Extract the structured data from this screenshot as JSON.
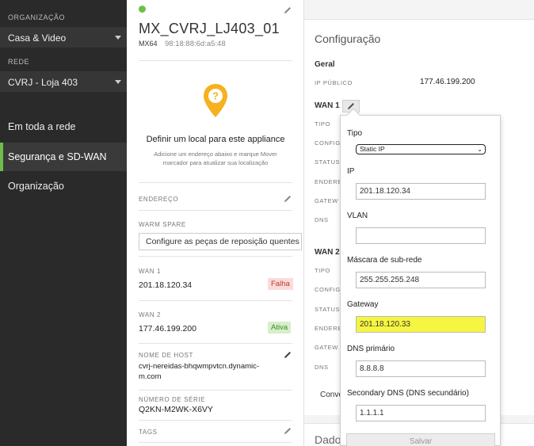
{
  "sidebar": {
    "org_label": "ORGANIZAÇÃO",
    "org_value": "Casa & Video",
    "network_label": "REDE",
    "network_value": "CVRJ - Loja 403",
    "nav": [
      "Em toda a rede",
      "Segurança e SD-WAN",
      "Organização"
    ],
    "active_nav": "Segurança e SD-WAN"
  },
  "device": {
    "status_color": "#6cc04a",
    "name": "MX_CVRJ_LJ403_01",
    "model": "MX64",
    "mac": "98:18:88:6d:a5:48",
    "location_title": "Definir um local para este appliance",
    "location_desc": "Adicione um endereço abaixo e marque Mover marcador para atualizar sua localização",
    "address_label": "ENDEREÇO",
    "warm_spare_label": "WARM SPARE",
    "warm_spare_value": "Configure as peças de reposição quentes",
    "wan1_label": "WAN 1",
    "wan1_ip": "201.18.120.34",
    "wan1_status": "Falha",
    "wan2_label": "WAN 2",
    "wan2_ip": "177.46.199.200",
    "wan2_status": "Ativa",
    "hostname_label": "NOME DE HOST",
    "hostname_value": "cvrj-nereidas-bhqwmpvtcn.dynamic-m.com",
    "serial_label": "NÚMERO DE SÉRIE",
    "serial_value": "Q2KN-M2WK-X6VY",
    "tags_label": "TAGS"
  },
  "config": {
    "title": "Configuração",
    "general": "Geral",
    "public_ip_label": "IP PÚBLICO",
    "public_ip_value": "177.46.199.200",
    "wan1_heading": "WAN 1",
    "wan2_heading": "WAN 2",
    "row_labels": [
      "TIPO",
      "CONFIG",
      "STATUS",
      "ENDERE",
      "GATEW",
      "DNS"
    ],
    "conv_text": "Conve",
    "dados_text": "Dado"
  },
  "popover": {
    "tipo_label": "Tipo",
    "tipo_value": "Static IP",
    "ip_label": "IP",
    "ip_value": "201.18.120.34",
    "vlan_label": "VLAN",
    "vlan_value": "",
    "mask_label": "Máscara de sub-rede",
    "mask_value": "255.255.255.248",
    "gateway_label": "Gateway",
    "gateway_value": "201.18.120.33",
    "dns1_label": "DNS primário",
    "dns1_value": "8.8.8.8",
    "dns2_label": "Secondary DNS (DNS secundário)",
    "dns2_value": "1.1.1.1",
    "save_label": "Salvar"
  }
}
